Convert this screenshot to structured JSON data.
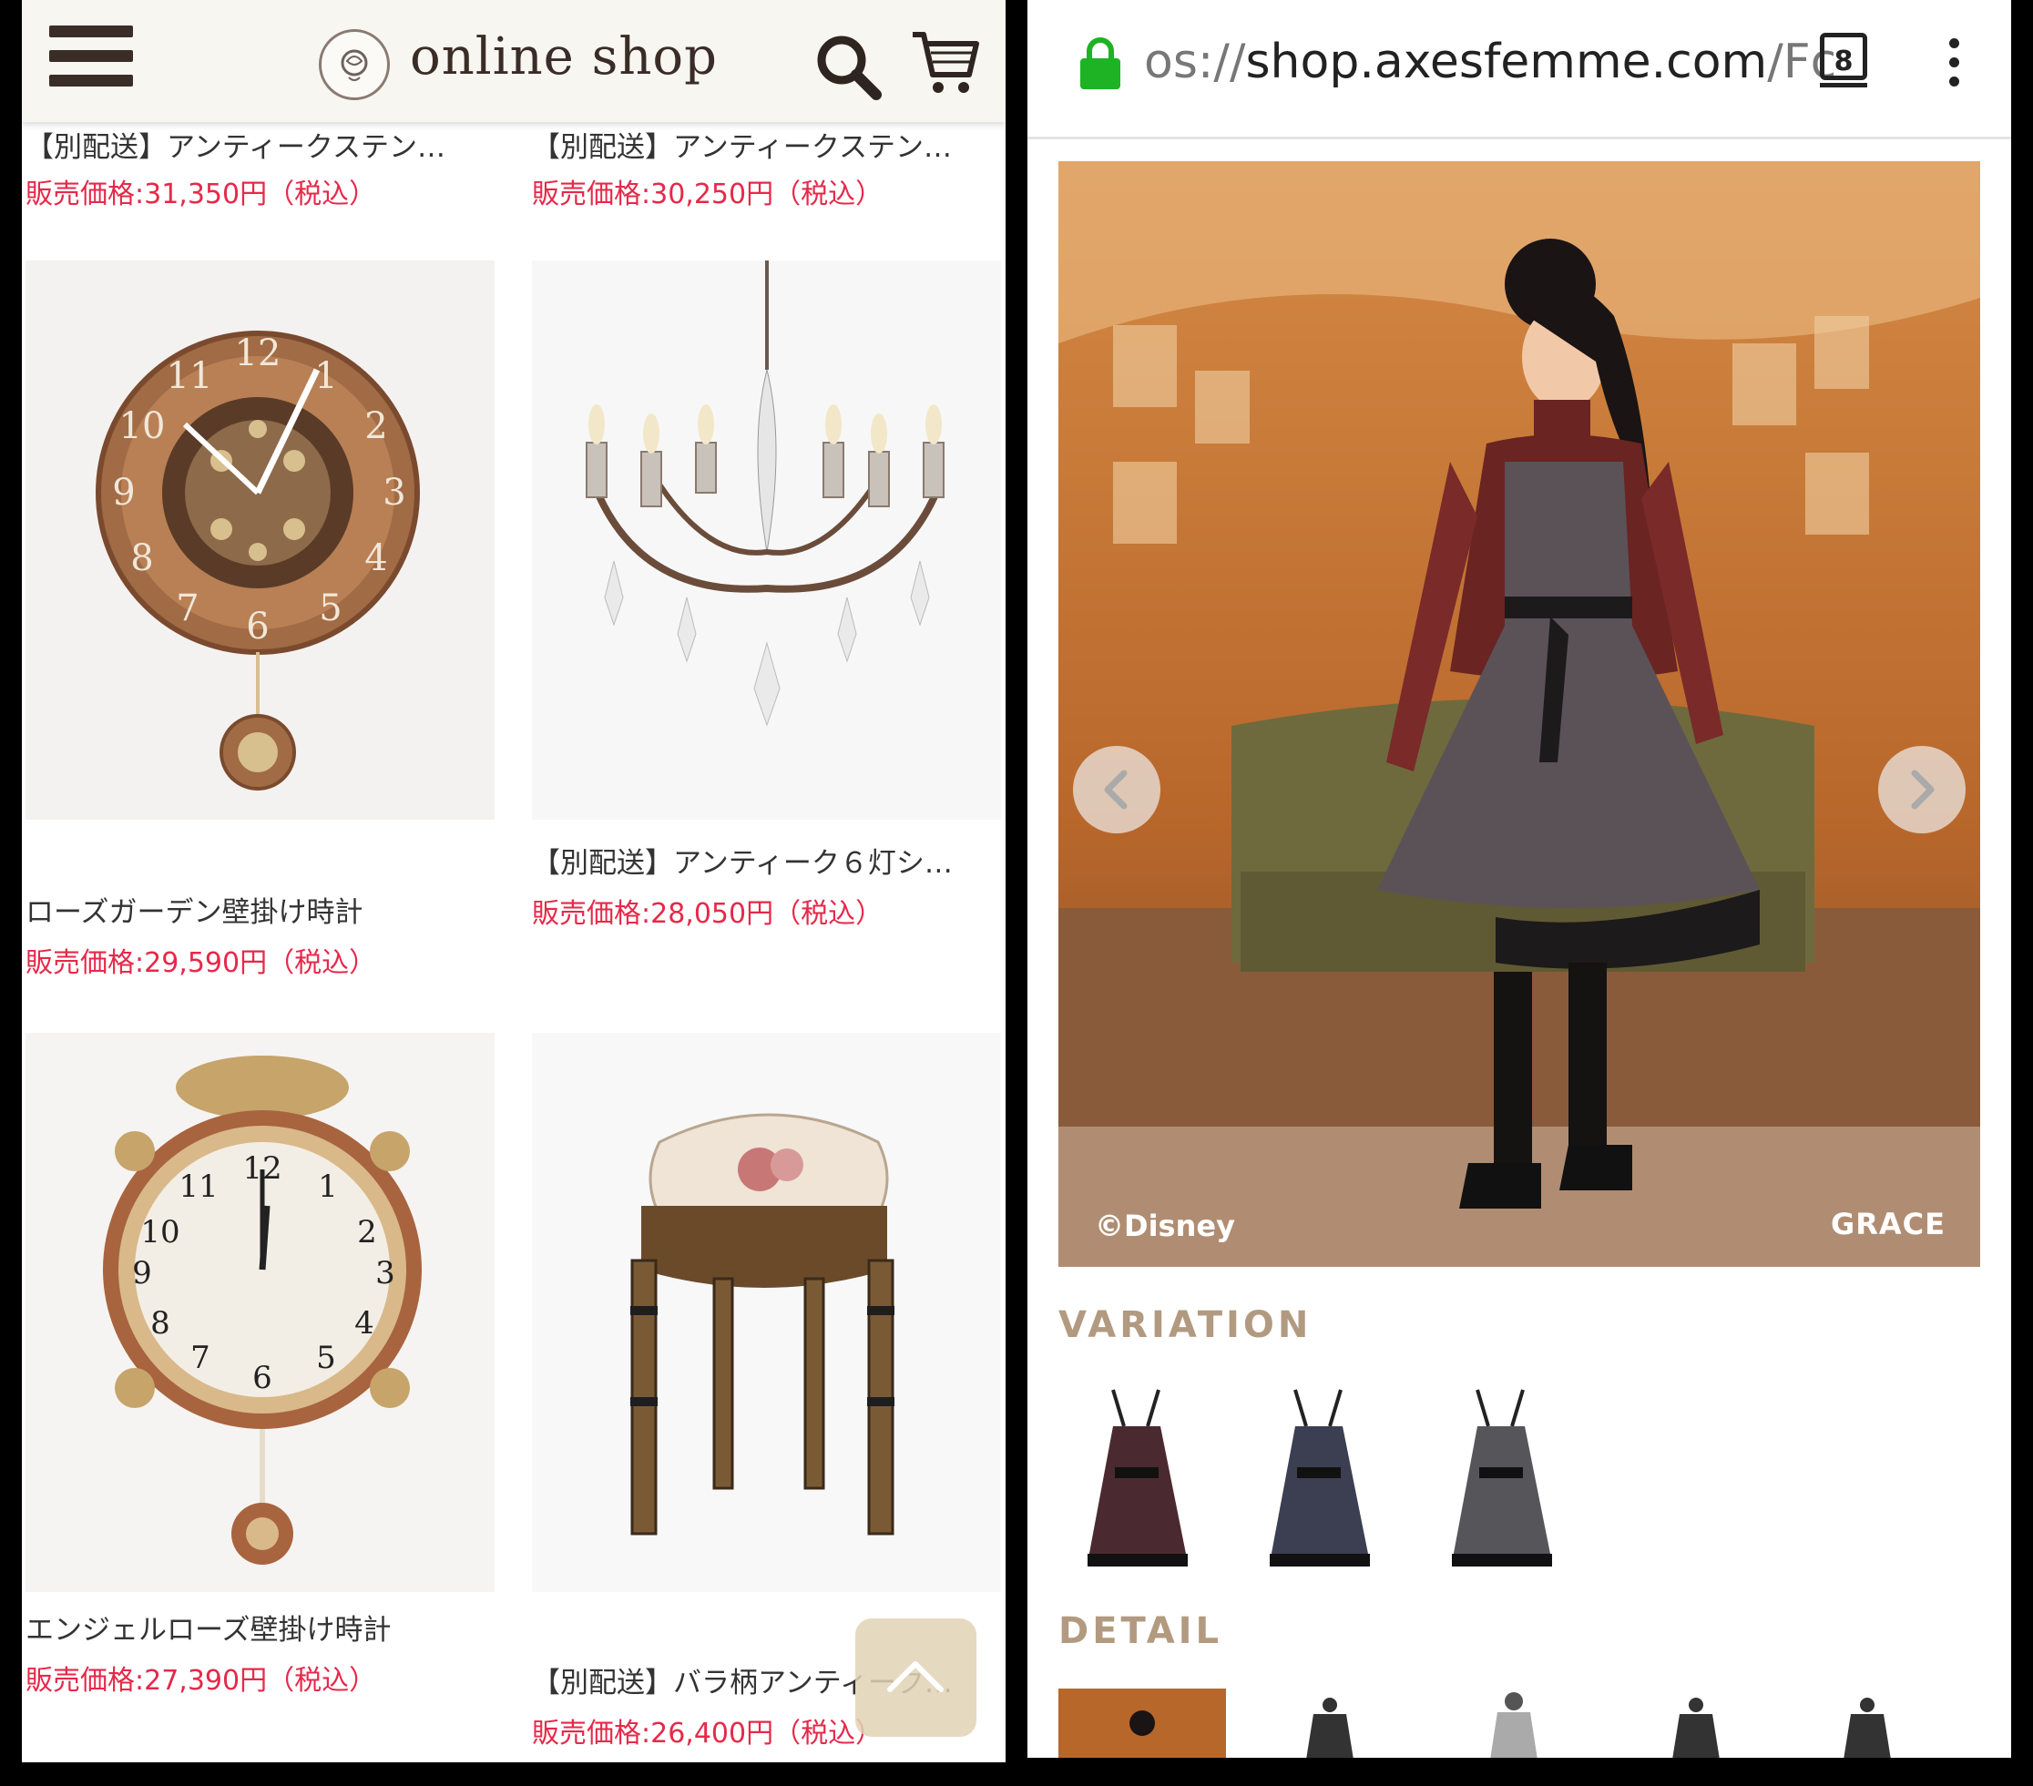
{
  "left": {
    "header": {
      "logo_text": "online shop",
      "menu_icon": "hamburger-menu-icon",
      "search_icon": "search-icon",
      "cart_icon": "cart-icon"
    },
    "products": [
      {
        "name": "【別配送】アンティークステン…",
        "price": "販売価格:31,350円（税込）"
      },
      {
        "name": "【別配送】アンティークステン…",
        "price": "販売価格:30,250円（税込）"
      },
      {
        "name": "ローズガーデン壁掛け時計",
        "price": "販売価格:29,590円（税込）"
      },
      {
        "name": "【別配送】アンティーク６灯シ…",
        "price": "販売価格:28,050円（税込）"
      },
      {
        "name": "エンジェルローズ壁掛け時計",
        "price": "販売価格:27,390円（税込）"
      },
      {
        "name": "【別配送】バラ柄アンティーク…",
        "price": "販売価格:26,400円（税込）"
      }
    ]
  },
  "right": {
    "browser": {
      "url_scheme": "os://",
      "url_host": "shop.axesfemme.com",
      "url_path": "/Fc",
      "tab_count": "8"
    },
    "hero": {
      "copyright": "©Disney",
      "brand": "GRACE"
    },
    "sections": {
      "variation": "VARIATION",
      "detail": "DETAIL"
    }
  },
  "colors": {
    "price": "#e6294a",
    "section_heading": "#b29a80",
    "header_bg": "#f8f6f0",
    "lock": "#1db324"
  }
}
